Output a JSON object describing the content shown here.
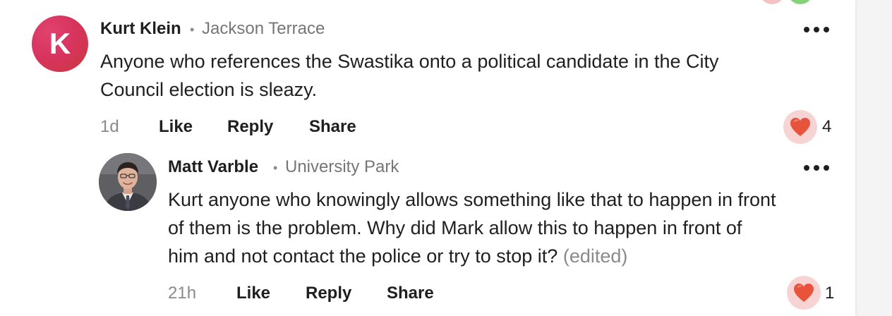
{
  "comment": {
    "avatar_letter": "K",
    "author": "Kurt Klein",
    "separator": "•",
    "location": "Jackson Terrace",
    "text_line1": "Anyone who references the Swastika onto a political candidate in the City",
    "text_line2": "Council election is sleazy.",
    "time": "1d",
    "like_label": "Like",
    "reply_label": "Reply",
    "share_label": "Share",
    "reaction_count": "4",
    "reaction_icon": "heart-icon",
    "more_icon": "more-options-icon"
  },
  "reply": {
    "author": "Matt Varble",
    "separator": "•",
    "location": "University Park",
    "text_line1": "Kurt anyone who knowingly allows something like that to happen in front",
    "text_line2": "of them is the problem. Why did Mark allow this to happen in front of",
    "text_line3": "him and not contact the police or try to stop it?",
    "edited_label": "(edited)",
    "time": "21h",
    "like_label": "Like",
    "reply_label": "Reply",
    "share_label": "Share",
    "reaction_count": "1",
    "reaction_icon": "heart-icon",
    "more_icon": "more-options-icon"
  },
  "colors": {
    "avatar_gradient_start": "#e0436e",
    "avatar_gradient_end": "#c63a3a",
    "heart": "#e8533b",
    "heart_bg": "#f8d3d3",
    "muted_text": "#767676"
  }
}
